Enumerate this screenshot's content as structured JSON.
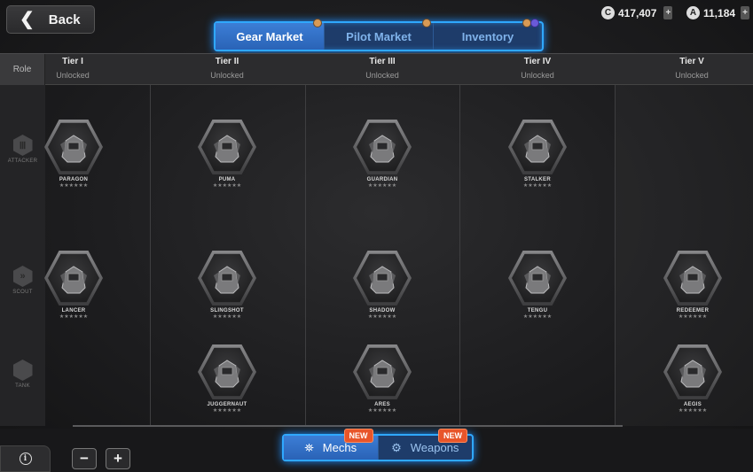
{
  "nav": {
    "back_label": "Back",
    "back_icon": "chevron-left-icon"
  },
  "market_tabs": [
    {
      "label": "Gear Market",
      "active": true
    },
    {
      "label": "Pilot Market",
      "active": false
    },
    {
      "label": "Inventory",
      "active": false
    }
  ],
  "currency": {
    "credits": "417,407",
    "gold": "11,184"
  },
  "header": {
    "role_label": "Role",
    "tiers": [
      {
        "name": "Tier I",
        "status": "Unlocked"
      },
      {
        "name": "Tier II",
        "status": "Unlocked"
      },
      {
        "name": "Tier III",
        "status": "Unlocked"
      },
      {
        "name": "Tier IV",
        "status": "Unlocked"
      },
      {
        "name": "Tier V",
        "status": "Unlocked"
      }
    ]
  },
  "roles": [
    {
      "name": "ATTACKER",
      "icon": "attacker-role-icon"
    },
    {
      "name": "SCOUT",
      "icon": "scout-role-icon"
    },
    {
      "name": "TANK",
      "icon": "tank-role-icon"
    }
  ],
  "mechs": [
    {
      "name": "PARAGON",
      "tier": "Tier I",
      "role": "ATTACKER",
      "stars": "★★★★★★"
    },
    {
      "name": "PUMA",
      "tier": "Tier II",
      "role": "ATTACKER",
      "stars": "★★★★★★"
    },
    {
      "name": "GUARDIAN",
      "tier": "Tier III",
      "role": "ATTACKER",
      "stars": "★★★★★★"
    },
    {
      "name": "STALKER",
      "tier": "Tier IV",
      "role": "ATTACKER",
      "stars": "★★★★★★"
    },
    {
      "name": "LANCER",
      "tier": "Tier I",
      "role": "SCOUT",
      "stars": "★★★★★★"
    },
    {
      "name": "SLINGSHOT",
      "tier": "Tier II",
      "role": "SCOUT",
      "stars": "★★★★★★"
    },
    {
      "name": "SHADOW",
      "tier": "Tier III",
      "role": "SCOUT",
      "stars": "★★★★★★"
    },
    {
      "name": "TENGU",
      "tier": "Tier IV",
      "role": "SCOUT",
      "stars": "★★★★★★"
    },
    {
      "name": "REDEEMER",
      "tier": "Tier V",
      "role": "SCOUT",
      "stars": "★★★★★★"
    },
    {
      "name": "JUGGERNAUT",
      "tier": "Tier II",
      "role": "TANK",
      "stars": "★★★★★★"
    },
    {
      "name": "ARES",
      "tier": "Tier III",
      "role": "TANK",
      "stars": "★★★★★★"
    },
    {
      "name": "AEGIS",
      "tier": "Tier V",
      "role": "TANK",
      "stars": "★★★★★★"
    }
  ],
  "bottom": {
    "info_icon": "i",
    "zoom_out": "−",
    "zoom_in": "+",
    "categories": [
      {
        "label": "Mechs",
        "badge": "NEW",
        "icon": "mech-icon",
        "active": true
      },
      {
        "label": "Weapons",
        "badge": "NEW",
        "icon": "weapon-icon",
        "active": false
      }
    ]
  },
  "colors": {
    "accent_blue": "#2fa8ff",
    "tab_active": "#3c7ed6",
    "new_badge": "#e8552a",
    "notify_dot": "#d89a55"
  }
}
